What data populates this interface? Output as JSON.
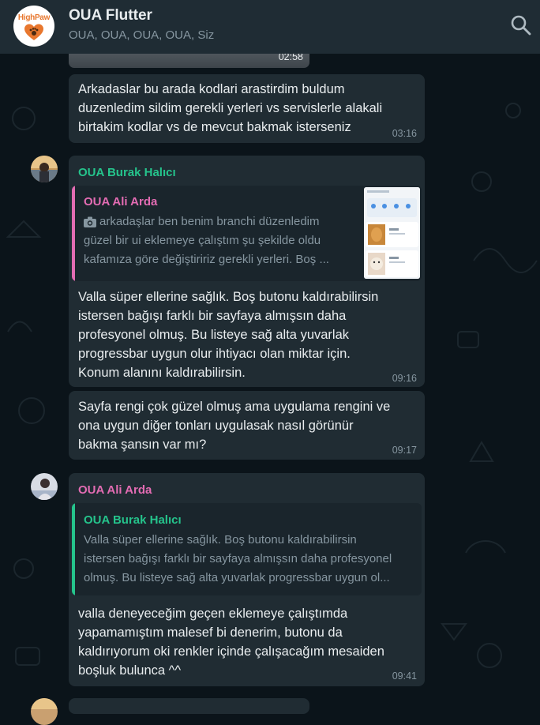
{
  "header": {
    "logo_text": "HighPaw",
    "title": "OUA Flutter",
    "subtitle": "OUA, OUA, OUA, OUA, Siz"
  },
  "colors": {
    "background": "#0b141a",
    "header": "#1f2c34",
    "bubble": "#202c33",
    "sender_green": "#25c48c",
    "sender_pink": "#e36cb3",
    "meta_gray": "#8696a0"
  },
  "messages": {
    "media_time": "02:58",
    "m1": {
      "text": "Arkadaslar bu arada kodlari arastirdim buldum\nduzenledim sildim gerekli yerleri vs servislerle alakali\nbirtakim kodlar vs de mevcut bakmak isterseniz",
      "time": "03:16"
    },
    "m2": {
      "sender": "OUA Burak Halıcı",
      "quote_author": "OUA Ali Arda",
      "quote_text": "arkadaşlar ben benim branchi düzenledim\ngüzel bir ui eklemeye çalıştım şu şekilde oldu\nkafamıza göre değiştiririz gerekli yerleri. Boş ...",
      "text": "Valla süper ellerine sağlık. Boş butonu kaldırabilirsin\nistersen bağışı farklı bir sayfaya almışsın daha\nprofesyonel olmuş. Bu listeye sağ alta yuvarlak\nprogressbar uygun olur ihtiyacı olan miktar için.\nKonum alanını kaldırabilirsin.",
      "time": "09:16"
    },
    "m3": {
      "text": "Sayfa rengi çok güzel olmuş ama uygulama rengini ve\nona uygun diğer tonları uygulasak nasıl görünür\nbakma şansın var mı?",
      "time": "09:17"
    },
    "m4": {
      "sender": "OUA Ali Arda",
      "quote_author": "OUA Burak Halıcı",
      "quote_text": "Valla süper ellerine sağlık. Boş butonu kaldırabilirsin\nistersen bağışı farklı bir sayfaya almışsın daha profesyonel\nolmuş. Bu listeye sağ alta yuvarlak progressbar uygun ol...",
      "text": "valla deneyeceğim geçen eklemeye çalıştımda\nyapamamıştım malesef bi denerim, butonu da\nkaldırıyorum oki renkler içinde çalışacağım mesaiden\nboşluk bulunca ^^",
      "time": "09:41"
    }
  }
}
